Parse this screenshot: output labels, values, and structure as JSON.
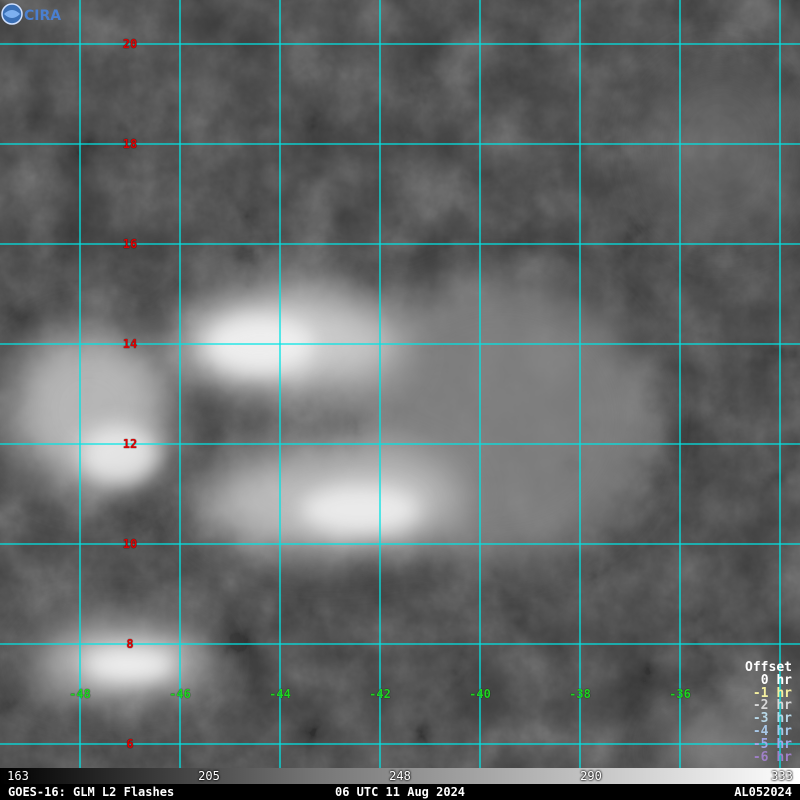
{
  "map": {
    "latitudes": [
      "20",
      "18",
      "16",
      "14",
      "12",
      "10",
      "8",
      "6"
    ],
    "longitudes": [
      "-48",
      "-46",
      "-44",
      "-42",
      "-40",
      "-38",
      "-36"
    ],
    "grid_color": "#00e5e5",
    "lat_label_color": "#e00000",
    "lon_label_color": "#1fd61f"
  },
  "legend": {
    "title": "Offset",
    "items": [
      {
        "label": "0 hr",
        "color": "#ffffff"
      },
      {
        "label": "-1 hr",
        "color": "#f5f0a0"
      },
      {
        "label": "-2 hr",
        "color": "#d8d8d8"
      },
      {
        "label": "-3 hr",
        "color": "#b8d8e8"
      },
      {
        "label": "-4 hr",
        "color": "#a8c8e8"
      },
      {
        "label": "-5 hr",
        "color": "#a0a8e8"
      },
      {
        "label": "-6 hr",
        "color": "#a080c8"
      }
    ]
  },
  "colorbar": {
    "ticks": [
      "163",
      "205",
      "248",
      "290",
      "333"
    ]
  },
  "status": {
    "left": "GOES-16: GLM L2 Flashes",
    "center": "06 UTC 11 Aug 2024",
    "right": "AL052024"
  },
  "logo": {
    "name": "cira-logo",
    "text": "CIRA"
  }
}
